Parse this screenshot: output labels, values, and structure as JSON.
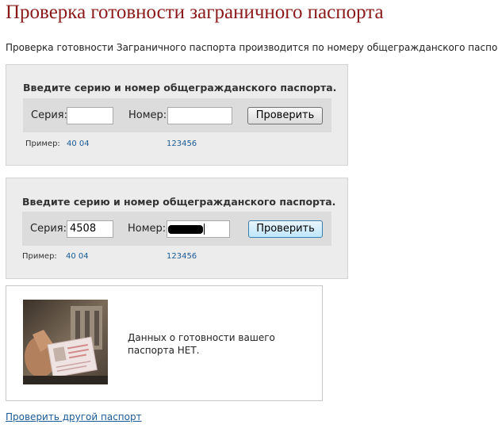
{
  "page": {
    "title": "Проверка готовности заграничного паспорта",
    "intro": "Проверка готовности Заграничного паспорта производится по номеру общегражданского паспорта."
  },
  "form1": {
    "heading": "Введите серию и номер общегражданского паспорта.",
    "series_label": "Серия:",
    "series_value": "",
    "number_label": "Номер:",
    "number_value": "",
    "button_label": "Проверить",
    "example_label": "Пример:",
    "example_series": "40 04",
    "example_number": "123456"
  },
  "form2": {
    "heading": "Введите серию и номер общегражданского паспорта.",
    "series_label": "Серия:",
    "series_value": "4508",
    "number_label": "Номер:",
    "number_value": "",
    "number_redacted": true,
    "button_label": "Проверить",
    "example_label": "Пример:",
    "example_series": "40 04",
    "example_number": "123456"
  },
  "result": {
    "message": "Данных о готовности вашего паспорта НЕТ.",
    "image_icon": "passport-photo"
  },
  "footer": {
    "link_label": "Проверить другой паспорт"
  },
  "colors": {
    "title": "#8b1a1a",
    "link": "#1a5a96",
    "panel": "#ececec",
    "form_bar": "#dcdcdc"
  }
}
